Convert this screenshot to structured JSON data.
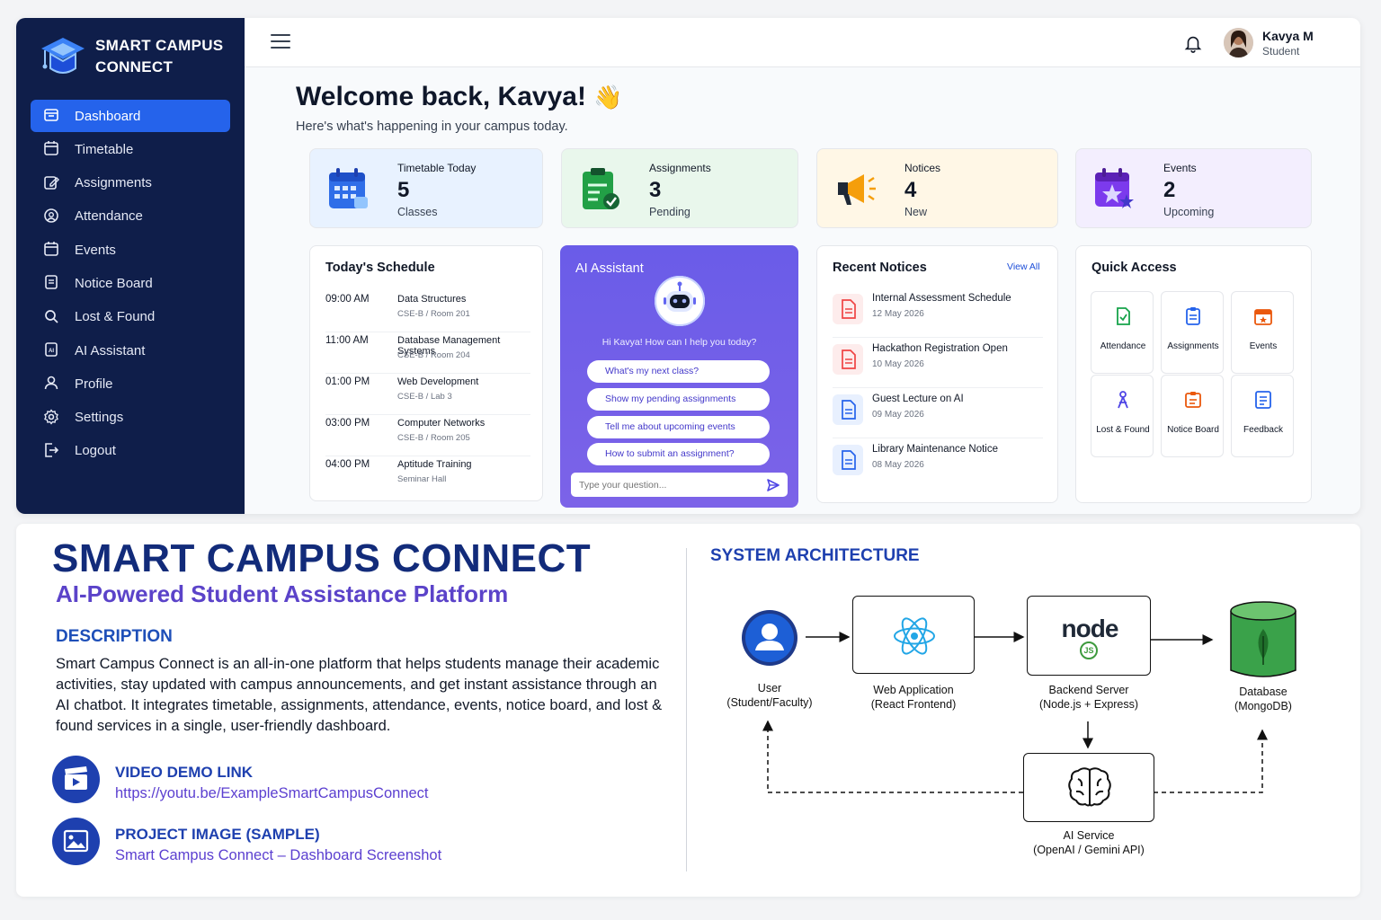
{
  "brand": {
    "line1": "SMART CAMPUS",
    "line2": "CONNECT"
  },
  "sidebar": {
    "items": [
      {
        "label": "Dashboard",
        "icon": "dashboard-icon",
        "active": true
      },
      {
        "label": "Timetable",
        "icon": "calendar-icon"
      },
      {
        "label": "Assignments",
        "icon": "edit-icon"
      },
      {
        "label": "Attendance",
        "icon": "attendance-icon"
      },
      {
        "label": "Events",
        "icon": "calendar-icon"
      },
      {
        "label": "Notice Board",
        "icon": "notice-icon"
      },
      {
        "label": "Lost & Found",
        "icon": "search-icon"
      },
      {
        "label": "AI Assistant",
        "icon": "ai-icon"
      },
      {
        "label": "Profile",
        "icon": "user-icon"
      },
      {
        "label": "Settings",
        "icon": "gear-icon"
      },
      {
        "label": "Logout",
        "icon": "logout-icon"
      }
    ]
  },
  "header": {
    "user_name": "Kavya M",
    "user_role": "Student"
  },
  "welcome": {
    "title": "Welcome back, Kavya!",
    "emoji": "👋",
    "subtitle": "Here's what's happening in your campus today."
  },
  "stats": [
    {
      "label": "Timetable Today",
      "value": "5",
      "sub": "Classes",
      "color": "#2563eb"
    },
    {
      "label": "Assignments",
      "value": "3",
      "sub": "Pending",
      "color": "#16a34a"
    },
    {
      "label": "Notices",
      "value": "4",
      "sub": "New",
      "color": "#f59e0b"
    },
    {
      "label": "Events",
      "value": "2",
      "sub": "Upcoming",
      "color": "#7c3aed"
    }
  ],
  "schedule": {
    "title": "Today's Schedule",
    "rows": [
      {
        "time": "09:00 AM",
        "subject": "Data Structures",
        "room": "CSE-B / Room 201"
      },
      {
        "time": "11:00 AM",
        "subject": "Database Management Systems",
        "room": "CSE-B / Room 204"
      },
      {
        "time": "01:00 PM",
        "subject": "Web Development",
        "room": "CSE-B / Lab 3"
      },
      {
        "time": "03:00 PM",
        "subject": "Computer Networks",
        "room": "CSE-B / Room 205"
      },
      {
        "time": "04:00 PM",
        "subject": "Aptitude Training",
        "room": "Seminar Hall"
      }
    ]
  },
  "ai": {
    "title": "AI Assistant",
    "greeting": "Hi Kavya! How can I help you today?",
    "chips": [
      "What's my next class?",
      "Show my pending assignments",
      "Tell me about upcoming events",
      "How to submit an assignment?"
    ],
    "placeholder": "Type your question..."
  },
  "notices": {
    "title": "Recent Notices",
    "view_all": "View All",
    "items": [
      {
        "title": "Internal Assessment Schedule",
        "date": "12 May 2026",
        "color": "red"
      },
      {
        "title": "Hackathon Registration Open",
        "date": "10 May 2026",
        "color": "red"
      },
      {
        "title": "Guest Lecture on AI",
        "date": "09 May 2026",
        "color": "blue"
      },
      {
        "title": "Library Maintenance Notice",
        "date": "08 May 2026",
        "color": "blue"
      }
    ]
  },
  "quick_access": {
    "title": "Quick Access",
    "tiles": [
      {
        "label": "Attendance",
        "icon": "attendance-icon"
      },
      {
        "label": "Assignments",
        "icon": "assignments-icon"
      },
      {
        "label": "Events",
        "icon": "events-icon"
      },
      {
        "label": "Lost & Found",
        "icon": "lost-found-icon"
      },
      {
        "label": "Notice Board",
        "icon": "notice-board-icon"
      },
      {
        "label": "Feedback",
        "icon": "feedback-icon"
      }
    ]
  },
  "info": {
    "title": "SMART CAMPUS CONNECT",
    "subtitle": "AI-Powered Student Assistance Platform",
    "desc_heading": "DESCRIPTION",
    "description": "Smart Campus Connect is an all-in-one platform that helps students manage their academic activities, stay updated with campus announcements, and get instant assistance through an AI chatbot. It integrates timetable, assignments, attendance, events, notice board, and lost & found services in a single, user-friendly dashboard.",
    "video_heading": "VIDEO DEMO LINK",
    "video_link": "https://youtu.be/ExampleSmartCampusConnect",
    "image_heading": "PROJECT IMAGE (SAMPLE)",
    "image_caption": "Smart Campus Connect – Dashboard Screenshot"
  },
  "architecture": {
    "heading": "SYSTEM ARCHITECTURE",
    "user": [
      "User",
      "(Student/Faculty)"
    ],
    "web": [
      "Web Application",
      "(React Frontend)"
    ],
    "backend": [
      "Backend Server",
      "(Node.js + Express)"
    ],
    "database": [
      "Database",
      "(MongoDB)"
    ],
    "ai": [
      "AI Service",
      "(OpenAI / Gemini API)"
    ],
    "node_logo": "node",
    "node_badge": "JS"
  }
}
